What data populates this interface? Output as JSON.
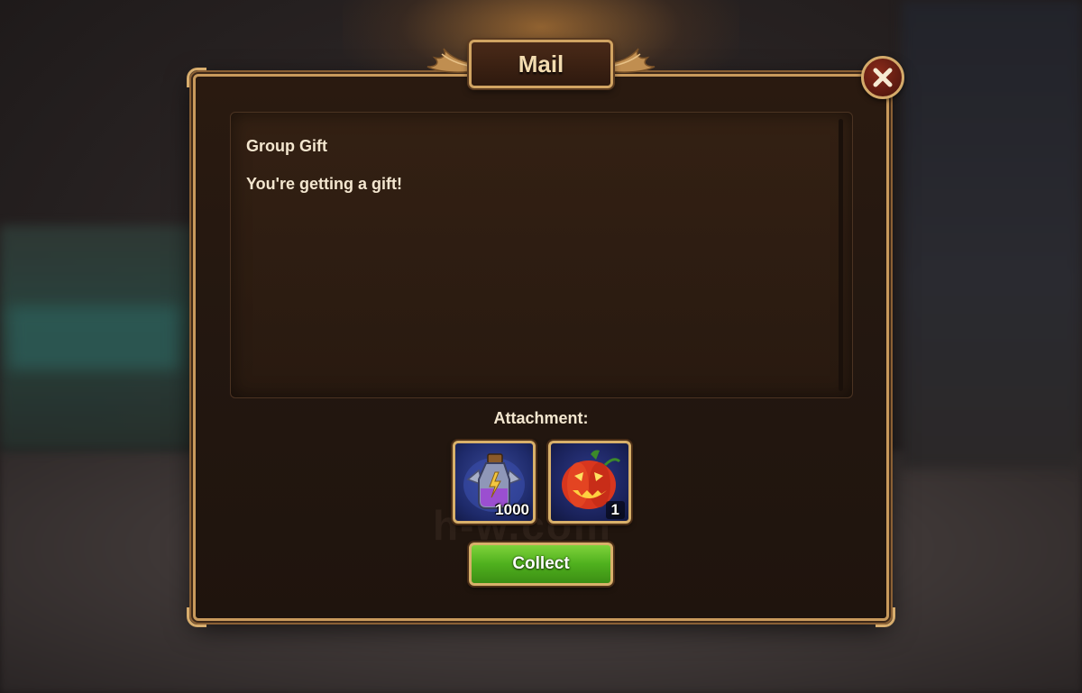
{
  "dialog": {
    "title": "Mail",
    "close_icon": "close-x-icon"
  },
  "message": {
    "subject": "Group Gift",
    "body": "You're getting a gift!"
  },
  "attachments": {
    "label": "Attachment:",
    "items": [
      {
        "icon": "potion-bottle-icon",
        "quantity": "1000"
      },
      {
        "icon": "jack-o-lantern-pumpkin-icon",
        "quantity": "1"
      }
    ]
  },
  "actions": {
    "collect_label": "Collect"
  },
  "watermark": "h-w.com",
  "colors": {
    "frame_gold": "#c99a5c",
    "panel_brown": "#231710",
    "collect_green": "#4fb01e",
    "close_red": "#5a1a10",
    "text_cream": "#f3e6cf"
  }
}
